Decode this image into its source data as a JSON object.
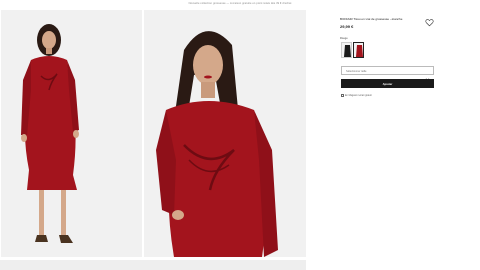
{
  "topbar": {
    "notice": "Nouvelle collection grossesse — Livraison gratuite en point relais dès 39 € d'achat"
  },
  "product": {
    "title": "BIO/FAIR Tissu en vrai de grossesse - étanche",
    "price": "29,99 €",
    "color_label": "Rouge",
    "size_placeholder": "Sélectionner taille",
    "add_label": "Ajouter",
    "pickup_text": "En Magasin retrait gratuit"
  },
  "colors": {
    "dress": "#a3141d",
    "dress_dark": "#6e0b12",
    "skin": "#d4a88a",
    "hair": "#2a1a14",
    "bg": "#f1f1f1"
  },
  "icons": [
    "heart-icon",
    "chevron-down-icon",
    "cart-icon",
    "store-icon"
  ]
}
